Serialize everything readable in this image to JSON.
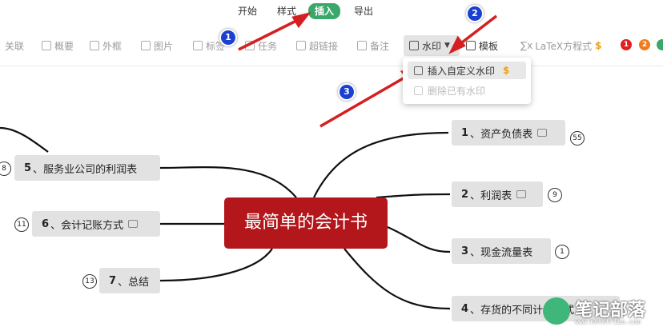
{
  "menu": {
    "items": [
      {
        "label": "开始"
      },
      {
        "label": "样式"
      },
      {
        "label": "插入"
      },
      {
        "label": "导出"
      }
    ]
  },
  "toolbar": {
    "items": [
      {
        "label": "关联",
        "icon": "link-icon"
      },
      {
        "label": "概要",
        "icon": "summary-icon"
      },
      {
        "label": "外框",
        "icon": "frame-icon"
      },
      {
        "label": "图片",
        "icon": "image-icon"
      },
      {
        "label": "标签",
        "icon": "tag-icon"
      },
      {
        "label": "任务",
        "icon": "task-icon"
      },
      {
        "label": "超链接",
        "icon": "hyperlink-icon"
      },
      {
        "label": "备注",
        "icon": "note-icon"
      },
      {
        "label": "水印",
        "icon": "watermark-icon"
      },
      {
        "label": "模板",
        "icon": "template-icon"
      },
      {
        "label": "LaTeX方程式",
        "icon": "formula-icon"
      }
    ],
    "badges": [
      "1",
      "2"
    ],
    "coin": "$"
  },
  "dropdown": {
    "insert_label": "插入自定义水印",
    "delete_label": "删除已有水印",
    "coin": "$"
  },
  "mindmap": {
    "central": "最简单的会计书",
    "right": [
      {
        "num": "1",
        "text": "资产负债表",
        "count": "55"
      },
      {
        "num": "2",
        "text": "利润表",
        "count": "9"
      },
      {
        "num": "3",
        "text": "现金流量表",
        "count": "1"
      },
      {
        "num": "4",
        "text": "存货的不同计价方式",
        "count": ""
      }
    ],
    "left": [
      {
        "num": "5",
        "text": "服务业公司的利润表",
        "count": "8"
      },
      {
        "num": "6",
        "text": "会计记账方式",
        "count": "11"
      },
      {
        "num": "7",
        "text": "总结",
        "count": "13"
      }
    ]
  },
  "markers": [
    "1",
    "2",
    "3"
  ],
  "watermark": {
    "title": "笔记部落",
    "url": "www.notetribe.com"
  },
  "colors": {
    "accent": "#3aa86a",
    "central": "#b3161b",
    "arrow": "#d42020",
    "marker": "#1a3fd1"
  }
}
